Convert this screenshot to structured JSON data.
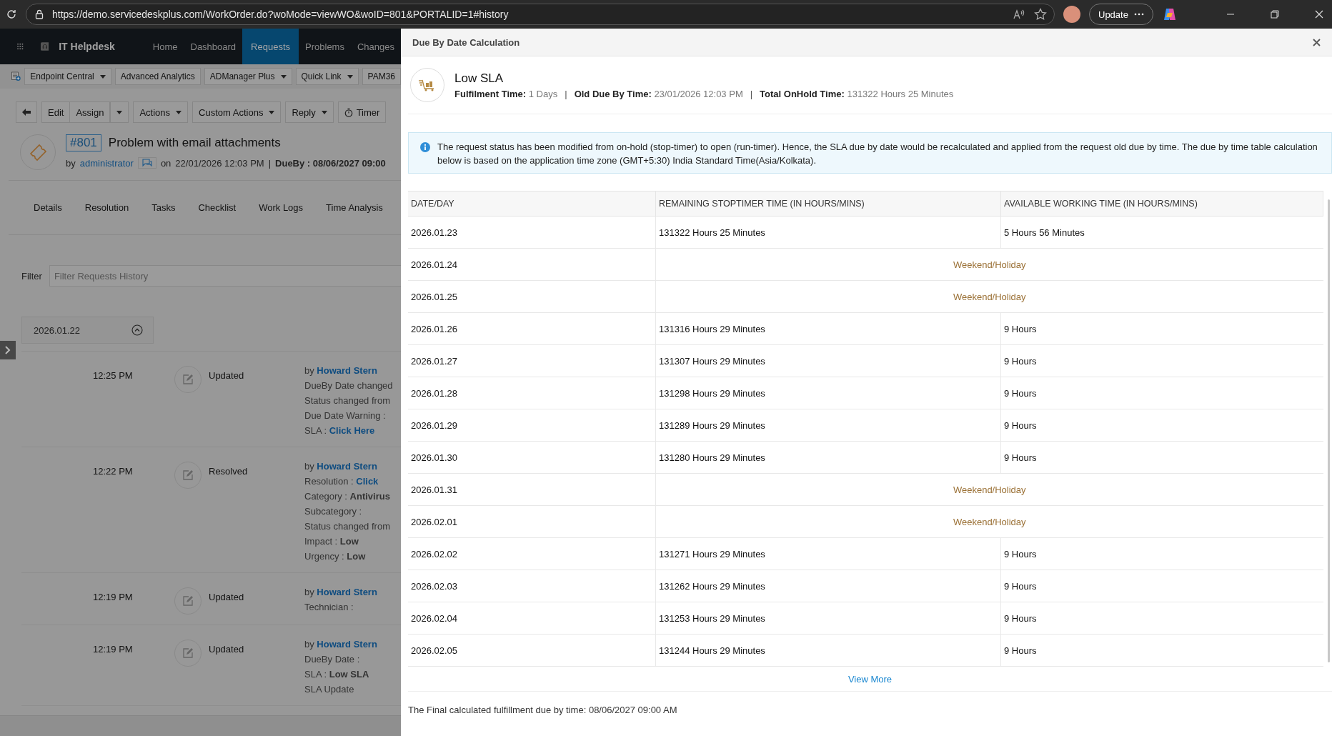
{
  "browser": {
    "url": "https://demo.servicedeskplus.com/WorkOrder.do?woMode=viewWO&woID=801&PORTALID=1#history",
    "update_button": "Update"
  },
  "app": {
    "title": "IT Helpdesk",
    "nav": [
      {
        "label": "Home",
        "selected": false
      },
      {
        "label": "Dashboard",
        "selected": false
      },
      {
        "label": "Requests",
        "selected": true
      },
      {
        "label": "Problems",
        "selected": false
      },
      {
        "label": "Changes",
        "selected": false
      }
    ]
  },
  "quick_links": [
    {
      "label": "Endpoint Central",
      "dropdown": true
    },
    {
      "label": "Advanced Analytics",
      "dropdown": false
    },
    {
      "label": "ADManager Plus",
      "dropdown": true
    },
    {
      "label": "Quick Link",
      "dropdown": true
    },
    {
      "label": "PAM36",
      "dropdown": false
    }
  ],
  "actions": [
    {
      "kind": "back"
    },
    {
      "kind": "button",
      "label": "Edit"
    },
    {
      "kind": "split",
      "label": "Assign"
    },
    {
      "kind": "dropdown",
      "label": "Actions"
    },
    {
      "kind": "dropdown",
      "label": "Custom Actions"
    },
    {
      "kind": "dropdown",
      "label": "Reply"
    },
    {
      "kind": "timer",
      "label": "Timer"
    }
  ],
  "request": {
    "number": "#801",
    "title": "Problem with email attachments",
    "by_label": "by",
    "author": "administrator",
    "on_label": "on",
    "created": "22/01/2026 12:03 PM",
    "separator": "|",
    "dueby": "DueBy : 08/06/2027 09:00"
  },
  "tabs": [
    "Details",
    "Resolution",
    "Tasks",
    "Checklist",
    "Work Logs",
    "Time Analysis"
  ],
  "filter": {
    "label": "Filter",
    "placeholder": "Filter Requests History"
  },
  "history": {
    "date": "2026.01.22",
    "expanded": true,
    "entries": [
      {
        "time": "12:25 PM",
        "action": "Updated",
        "lines": [
          {
            "text": "by",
            "link": "Howard Stern"
          },
          {
            "text": "DueBy Date changed"
          },
          {
            "text": "Status changed from"
          },
          {
            "text": "Due Date Warning :"
          },
          {
            "text": "SLA :",
            "link": "Click Here"
          }
        ]
      },
      {
        "time": "12:22 PM",
        "action": "Resolved",
        "lines": [
          {
            "text": "by",
            "link": "Howard Stern"
          },
          {
            "text": "Resolution :",
            "link": "Click"
          },
          {
            "text": "Category : **Antivirus**"
          },
          {
            "text": "Subcategory :"
          },
          {
            "text": "Status changed from"
          },
          {
            "text": "Impact : **Low**"
          },
          {
            "text": "Urgency : **Low**"
          }
        ]
      },
      {
        "time": "12:19 PM",
        "action": "Updated",
        "lines": [
          {
            "text": "by",
            "link": "Howard Stern"
          },
          {
            "text": "Technician :"
          }
        ]
      },
      {
        "time": "12:19 PM",
        "action": "Updated",
        "lines": [
          {
            "text": "by",
            "link": "Howard Stern"
          },
          {
            "text": "DueBy Date :"
          },
          {
            "text": "SLA : **Low SLA**"
          },
          {
            "text": "SLA Update"
          }
        ]
      }
    ]
  },
  "modal": {
    "title": "Due By Date Calculation",
    "sla_name": "Low SLA",
    "separator": "|",
    "facts": [
      {
        "label": "Fulfilment Time:",
        "value": "1 Days"
      },
      {
        "label": "Old Due By Time:",
        "value": "23/01/2026 12:03 PM"
      },
      {
        "label": "Total OnHold Time:",
        "value": "131322 Hours 25 Minutes"
      }
    ],
    "info": "The request status has been modified from on-hold (stop-timer) to open (run-timer). Hence, the SLA due by date would be recalculated and applied from the request old due by time. The due by time table calculation below is based on the application time zone (GMT+5:30) India Standard Time(Asia/Kolkata).",
    "columns": [
      "DATE/DAY",
      "REMAINING STOPTIMER TIME (IN HOURS/MINS)",
      "AVAILABLE WORKING TIME (IN HOURS/MINS)"
    ],
    "rows": [
      {
        "kind": "working",
        "date": "2026.01.23",
        "remaining": "131322 Hours 25 Minutes",
        "available": "5 Hours 56 Minutes"
      },
      {
        "kind": "holiday",
        "date": "2026.01.24",
        "note": "Weekend/Holiday"
      },
      {
        "kind": "holiday",
        "date": "2026.01.25",
        "note": "Weekend/Holiday"
      },
      {
        "kind": "working",
        "date": "2026.01.26",
        "remaining": "131316 Hours 29 Minutes",
        "available": "9 Hours"
      },
      {
        "kind": "working",
        "date": "2026.01.27",
        "remaining": "131307 Hours 29 Minutes",
        "available": "9 Hours"
      },
      {
        "kind": "working",
        "date": "2026.01.28",
        "remaining": "131298 Hours 29 Minutes",
        "available": "9 Hours"
      },
      {
        "kind": "working",
        "date": "2026.01.29",
        "remaining": "131289 Hours 29 Minutes",
        "available": "9 Hours"
      },
      {
        "kind": "working",
        "date": "2026.01.30",
        "remaining": "131280 Hours 29 Minutes",
        "available": "9 Hours"
      },
      {
        "kind": "holiday",
        "date": "2026.01.31",
        "note": "Weekend/Holiday"
      },
      {
        "kind": "holiday",
        "date": "2026.02.01",
        "note": "Weekend/Holiday"
      },
      {
        "kind": "working",
        "date": "2026.02.02",
        "remaining": "131271 Hours 29 Minutes",
        "available": "9 Hours"
      },
      {
        "kind": "working",
        "date": "2026.02.03",
        "remaining": "131262 Hours 29 Minutes",
        "available": "9 Hours"
      },
      {
        "kind": "working",
        "date": "2026.02.04",
        "remaining": "131253 Hours 29 Minutes",
        "available": "9 Hours"
      },
      {
        "kind": "working",
        "date": "2026.02.05",
        "remaining": "131244 Hours 29 Minutes",
        "available": "9 Hours"
      }
    ],
    "view_more": "View More",
    "final": "The Final calculated fulfillment due by time: 08/06/2027 09:00 AM"
  }
}
